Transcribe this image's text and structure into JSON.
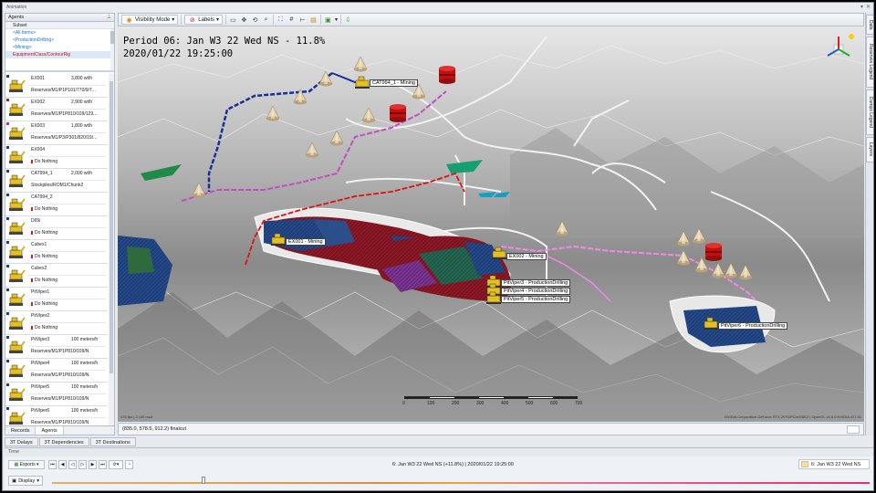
{
  "window": {
    "title": "Animation"
  },
  "agents_panel": {
    "title": "Agents",
    "subset_header": "Subset",
    "subsets": [
      "<All Items>",
      "<ProductionDrilling>",
      "<Mining>",
      "EquipmentClass/ContourRig"
    ],
    "agents": [
      {
        "name": "EX001",
        "rate": "3,800 wt/h",
        "task": "Reserves/M1/P1P101/770/9/7...",
        "marker": "#1a3b9a",
        "kind": "excavator"
      },
      {
        "name": "EX002",
        "rate": "2,900 wt/h",
        "task": "Reserves/M1/P1P810/109/129...",
        "marker": "#b02020",
        "kind": "excavator"
      },
      {
        "name": "EX003",
        "rate": "1,800 wt/h",
        "task": "Reserves/M1/P3/P301/820/19/...",
        "marker": "#9a3aa0",
        "kind": "excavator"
      },
      {
        "name": "EX004",
        "rate": "",
        "task": "Do Nothing",
        "marker": "#1a3b9a",
        "kind": "excavator",
        "idle": true
      },
      {
        "name": "CAT994_1",
        "rate": "2,000 wt/h",
        "task": "Stockpiles/ROM1/Chunk2",
        "marker": "#1a3b9a",
        "kind": "loader"
      },
      {
        "name": "CAT994_2",
        "rate": "",
        "task": "Do Nothing",
        "marker": "#1a3b9a",
        "kind": "loader",
        "idle": true
      },
      {
        "name": "D65i",
        "rate": "",
        "task": "Do Nothing",
        "marker": "#1a3b9a",
        "kind": "dozer",
        "idle": true
      },
      {
        "name": "Cubex1",
        "rate": "",
        "task": "Do Nothing",
        "marker": "#1a3b9a",
        "kind": "drill",
        "idle": true
      },
      {
        "name": "Cubex2",
        "rate": "",
        "task": "Do Nothing",
        "marker": "#1a3b9a",
        "kind": "drill",
        "idle": true
      },
      {
        "name": "PitViper1",
        "rate": "",
        "task": "Do Nothing",
        "marker": "#1a3b9a",
        "kind": "drill",
        "idle": true
      },
      {
        "name": "PitViper2",
        "rate": "",
        "task": "Do Nothing",
        "marker": "#1a3b9a",
        "kind": "drill",
        "idle": true
      },
      {
        "name": "PitViper3",
        "rate": "100 meters/h",
        "task": "Reserves/M1/P1P810/109/N",
        "marker": "#1a3b9a",
        "kind": "drill"
      },
      {
        "name": "PitViper4",
        "rate": "100 meters/h",
        "task": "Reserves/M1/P1P810/109/N",
        "marker": "#1a3b9a",
        "kind": "drill"
      },
      {
        "name": "PitViper5",
        "rate": "100 meters/h",
        "task": "Reserves/M1/P1P810/109/N",
        "marker": "#1a3b9a",
        "kind": "drill"
      },
      {
        "name": "PitViper6",
        "rate": "100 meters/h",
        "task": "Reserves/M1/P1P810/109/N",
        "marker": "#1a3b9a",
        "kind": "drill"
      }
    ],
    "tabs": [
      "Records",
      "Agents"
    ]
  },
  "bottom_tabs": [
    "3T Delays",
    "3T Dependencies",
    "3T Destinations"
  ],
  "toolbar": {
    "visibility_label": "Visibility Mode",
    "labels_label": "Labels"
  },
  "viewport": {
    "period_line1": "Period 06: Jan W3 22 Wed NS - 11.8%",
    "period_line2": "2020/01/22 19:25:00",
    "labels": {
      "cat994": "CAT994_1 - Mining",
      "ex001": "EX001 - Mining",
      "ex002": "EX002 - Mining",
      "pv3": "PitViper3 - ProductionDrilling",
      "pv4": "PitViper4 - ProductionDrilling",
      "pv5": "PitViper5 - ProductionDrilling",
      "pv6": "PitViper6 - ProductionDrilling"
    },
    "scale_ticks": [
      "0",
      "100",
      "200",
      "300",
      "400",
      "500",
      "600",
      "700"
    ],
    "fps_text": "476 fps | 2.100 ms/f",
    "gpu_text": "NVIDIA Corporation GeForce RTX 2070/PCIe/SSE2 | OpenGL v4.6.0 NVIDIA 417.51",
    "status_coords": "(835.0, 578.5, 912.2) finalcut"
  },
  "right_dock_tabs": [
    "Data",
    "Reserves Legend",
    "Dumps Legend",
    "Layers"
  ],
  "time_panel": {
    "title": "Time",
    "exports_label": "Exports",
    "period_center": "6: Jan W3 22 Wed NS (+11.8%) | 2020/01/22 19:25:00",
    "period_right": "6: Jan W3 22 Wed NS",
    "display_label": "Display",
    "playback_progress": 0.185
  }
}
